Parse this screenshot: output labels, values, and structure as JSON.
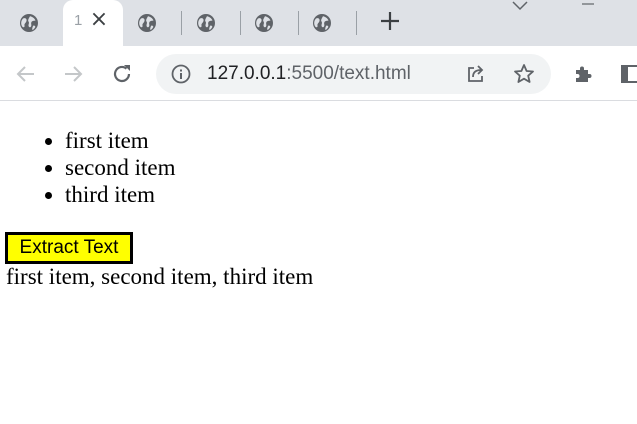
{
  "browser": {
    "active_tab": {
      "title": "1",
      "close_glyph": "×",
      "favicon": "globe-icon"
    },
    "other_tabs": [
      {
        "favicon": "globe-icon"
      },
      {
        "favicon": "globe-icon"
      },
      {
        "favicon": "globe-icon"
      },
      {
        "favicon": "globe-icon"
      },
      {
        "favicon": "globe-icon"
      }
    ],
    "new_tab_icon": "plus-icon",
    "address_bar": {
      "host": "127.0.0.1",
      "path": ":5500/text.html",
      "info_icon": "info-icon",
      "share_icon": "share-icon",
      "bookmark_icon": "star-icon"
    },
    "toolbar_icons": [
      "back-arrow-icon",
      "forward-arrow-icon",
      "reload-icon",
      "extensions-icon",
      "side-panel-icon"
    ]
  },
  "page": {
    "list_items": [
      "first item",
      "second item",
      "third item"
    ],
    "button_label": "Extract Text",
    "output_text": "first item, second item, third item"
  },
  "colors": {
    "tab_strip_bg": "#dee1e6",
    "omnibox_bg": "#f1f3f4",
    "button_bg": "#ffff00",
    "button_border": "#000000",
    "icon_color": "#5f6368"
  }
}
